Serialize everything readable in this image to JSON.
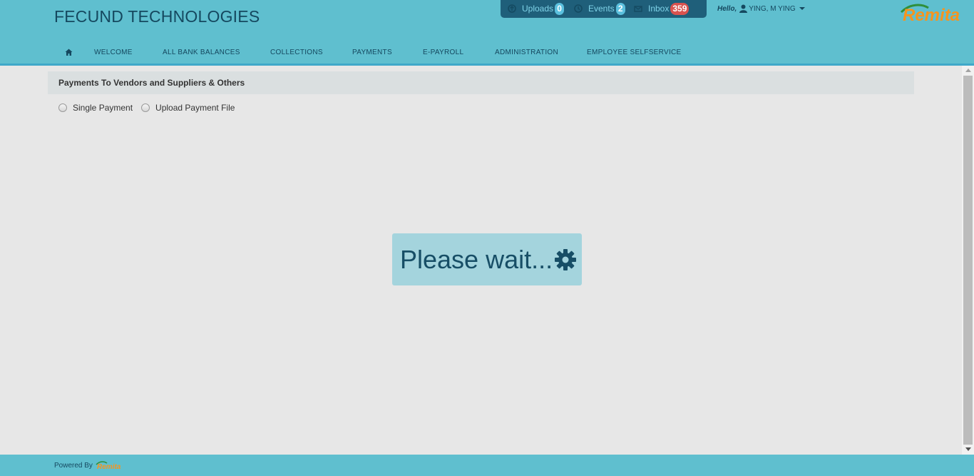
{
  "header": {
    "brand": "FECUND TECHNOLOGIES",
    "notifications": {
      "uploads_label": "Uploads",
      "uploads_count": "0",
      "events_label": "Events",
      "events_count": "2",
      "inbox_label": "Inbox",
      "inbox_count": "359"
    },
    "greeting": "Hello,",
    "user_name": "YING, M YING",
    "logo_text": "Remita"
  },
  "nav": {
    "items": [
      {
        "label": "WELCOME"
      },
      {
        "label": "ALL BANK BALANCES"
      },
      {
        "label": "COLLECTIONS"
      },
      {
        "label": "PAYMENTS"
      },
      {
        "label": "E-PAYROLL"
      },
      {
        "label": "ADMINISTRATION"
      },
      {
        "label": "EMPLOYEE SELFSERVICE"
      }
    ]
  },
  "main": {
    "panel_title": "Payments To Vendors and Suppliers & Others",
    "options": [
      {
        "label": "Single Payment",
        "selected": false
      },
      {
        "label": "Upload Payment File",
        "selected": false
      }
    ],
    "loading_text": "Please wait..."
  },
  "footer": {
    "powered_by": "Powered By",
    "logo_text": "Remita"
  },
  "colors": {
    "header_bg": "#5fbfcf",
    "brand_text": "#15485f",
    "notif_bar": "#1f5f7a",
    "badge_blue": "#5bc0de",
    "badge_red": "#d9534f",
    "logo_orange": "#f7941d",
    "wait_box": "#a4d4dd"
  },
  "icons": {
    "home": "home-icon",
    "uploads": "upload-icon",
    "events": "clock-icon",
    "inbox": "envelope-icon",
    "user": "user-icon",
    "loading": "gear-icon"
  }
}
